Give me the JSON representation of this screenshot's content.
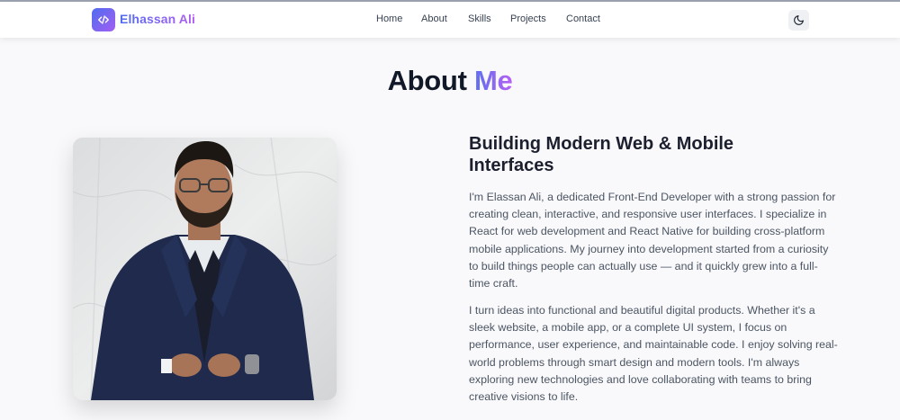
{
  "navbar": {
    "logo_text": "Elhassan Ali",
    "logo_icon": "code-icon",
    "links": [
      {
        "label": "Home"
      },
      {
        "label": "About"
      },
      {
        "label": "Skills"
      },
      {
        "label": "Projects"
      },
      {
        "label": "Contact"
      }
    ],
    "theme_toggle_icon": "moon-icon"
  },
  "about": {
    "title_main": "About",
    "title_accent": "Me",
    "heading": "Building Modern Web & Mobile Interfaces",
    "paragraphs": [
      "I'm Elassan Ali, a dedicated Front-End Developer with a strong passion for creating clean, interactive, and responsive user interfaces. I specialize in React for web development and React Native for building cross-platform mobile applications. My journey into development started from a curiosity to build things people can actually use — and it quickly grew into a full-time craft.",
      "I turn ideas into functional and beautiful digital products. Whether it's a sleek website, a mobile app, or a complete UI system, I focus on performance, user experience, and maintainable code. I enjoy solving real-world problems through smart design and modern tools. I'm always exploring new technologies and love collaborating with teams to bring creative visions to life."
    ]
  },
  "colors": {
    "accent_start": "#4f6cf0",
    "accent_end": "#b35ef1"
  }
}
